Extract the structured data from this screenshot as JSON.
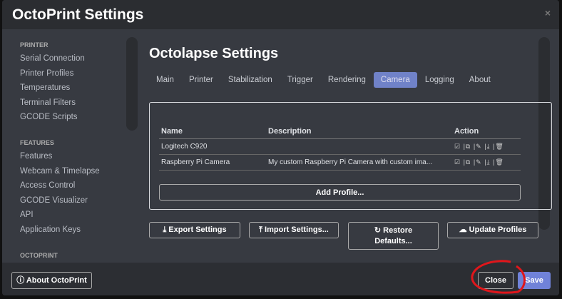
{
  "title": "OctoPrint Settings",
  "close_x": "×",
  "sidebar": {
    "sections": [
      {
        "title": "PRINTER",
        "items": [
          "Serial Connection",
          "Printer Profiles",
          "Temperatures",
          "Terminal Filters",
          "GCODE Scripts"
        ]
      },
      {
        "title": "FEATURES",
        "items": [
          "Features",
          "Webcam & Timelapse",
          "Access Control",
          "GCODE Visualizer",
          "API",
          "Application Keys"
        ]
      },
      {
        "title": "OCTOPRINT",
        "items": []
      }
    ]
  },
  "main": {
    "title": "Octolapse Settings",
    "tabs": [
      "Main",
      "Printer",
      "Stabilization",
      "Trigger",
      "Rendering",
      "Camera",
      "Logging",
      "About"
    ],
    "active_tab": "Camera",
    "table": {
      "headers": [
        "Name",
        "Description",
        "Action"
      ],
      "rows": [
        {
          "name": "Logitech C920",
          "description": ""
        },
        {
          "name": "Raspberry Pi Camera",
          "description": "My custom Raspberry Pi Camera with custom ima..."
        }
      ],
      "actions": "☑ |⧉ |✎ |⤓ |🗑"
    },
    "add_profile": "Add Profile...",
    "buttons": {
      "export": "⤓ Export Settings",
      "import": "⤒ Import Settings...",
      "restore1": "↻ Restore",
      "restore2": "Defaults...",
      "update": "☁ Update Profiles"
    }
  },
  "footer": {
    "about": "ⓘ About OctoPrint",
    "close": "Close",
    "save": "Save"
  }
}
